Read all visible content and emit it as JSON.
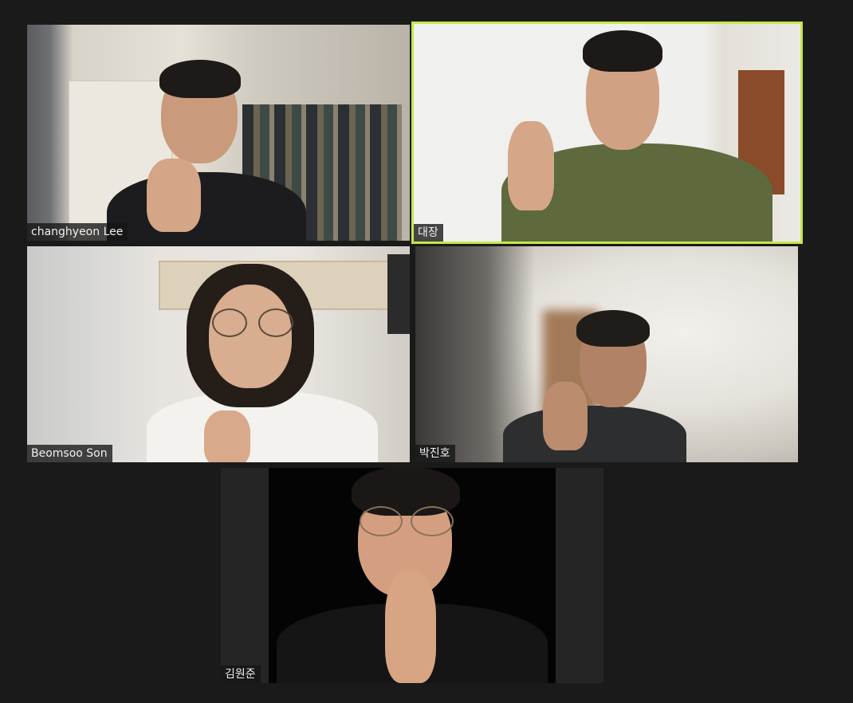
{
  "participants": [
    {
      "name": "changhyeon Lee",
      "active_speaker": false
    },
    {
      "name": "대장",
      "active_speaker": true
    },
    {
      "name": "Beomsoo Son",
      "active_speaker": false
    },
    {
      "name": "박진호",
      "active_speaker": false
    },
    {
      "name": "김원준",
      "active_speaker": false
    }
  ],
  "colors": {
    "background": "#1a1a1a",
    "active_speaker_border": "#c5e84a",
    "name_tag_bg": "#141414",
    "name_tag_text": "#f0f0f0"
  }
}
